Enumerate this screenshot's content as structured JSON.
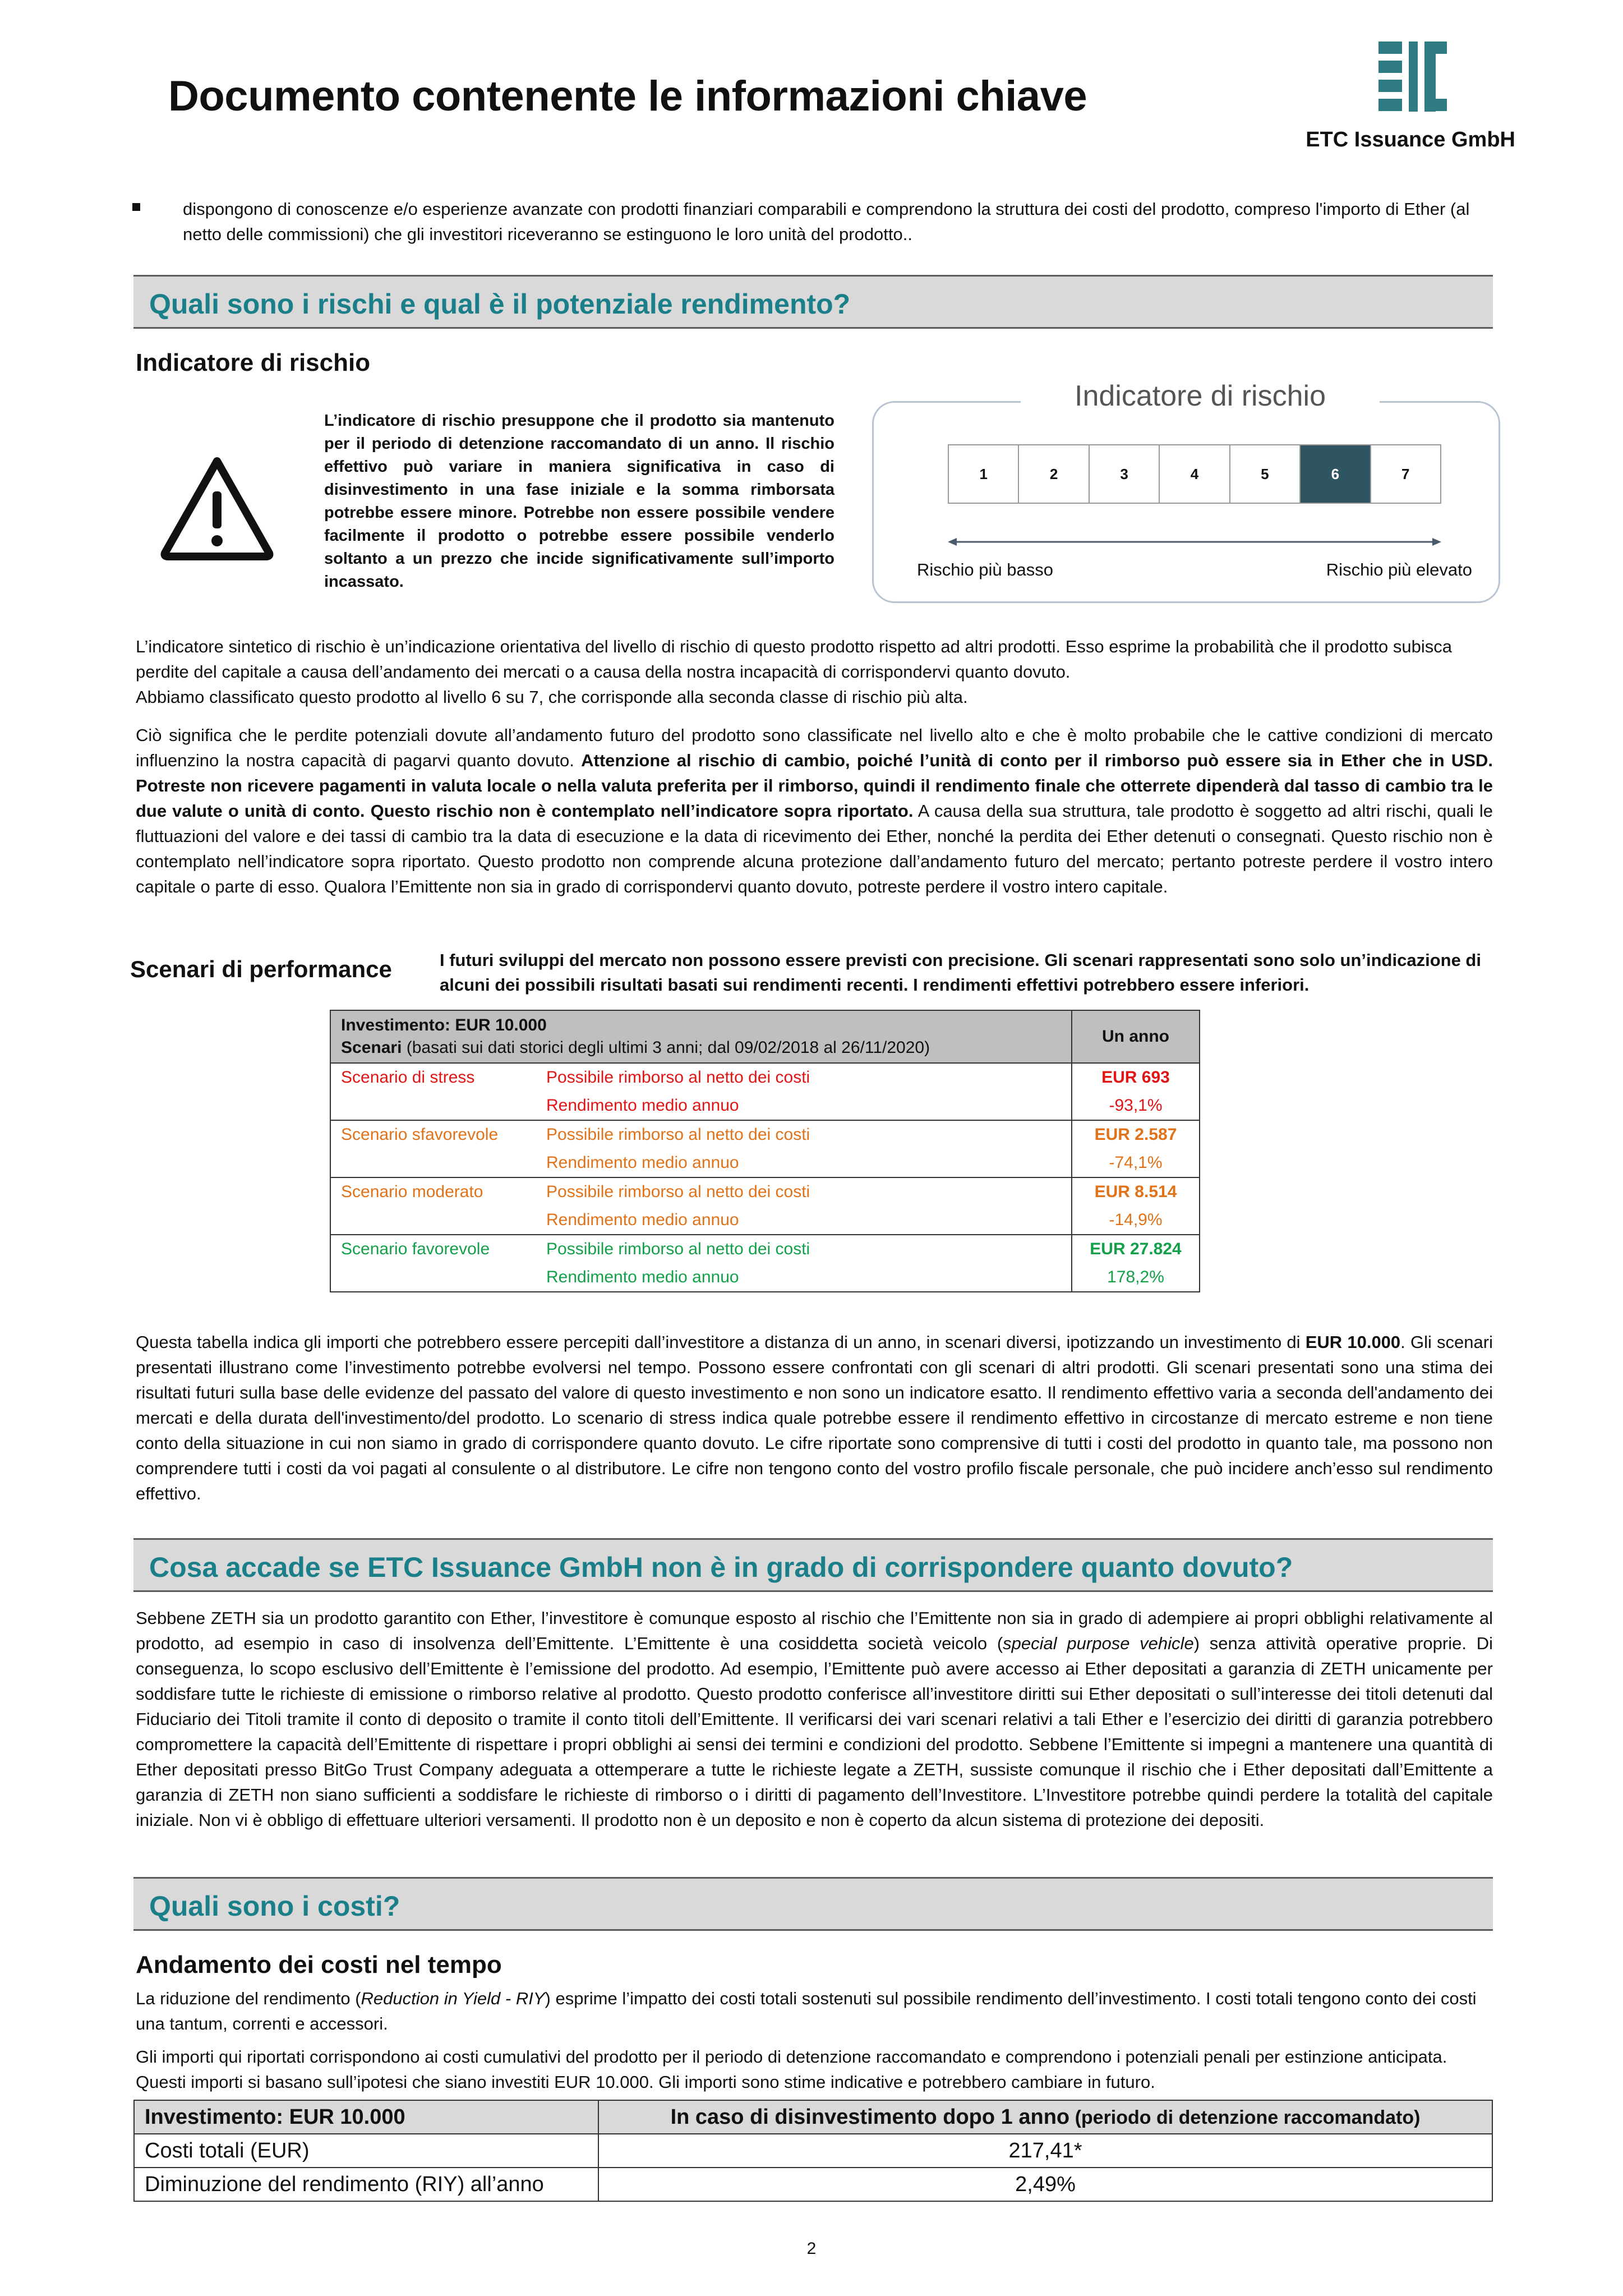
{
  "header": {
    "title": "Documento contenente le informazioni chiave",
    "issuer": "ETC Issuance GmbH"
  },
  "intro_bullet": "dispongono di conoscenze e/o esperienze avanzate con prodotti finanziari comparabili e comprendono la struttura dei costi del prodotto, compreso l'importo di Ether (al netto delle commissioni) che gli investitori riceveranno se estinguono le loro unità del prodotto..",
  "risk_section": {
    "heading": "Quali sono i rischi e qual è il potenziale rendimento?",
    "subheading": "Indicatore di rischio",
    "warning_text": "L’indicatore di rischio presuppone che il prodotto sia mantenuto per il periodo di detenzione raccomandato di un anno. Il rischio effettivo può variare in maniera significativa in caso di disinvestimento in una fase iniziale e la somma rimborsata potrebbe essere minore. Potrebbe non essere possibile vendere facilmente il prodotto o potrebbe essere possibile venderlo soltanto a un prezzo che incide significativamente sull’importo incassato.",
    "indicator": {
      "title": "Indicatore di rischio",
      "levels": [
        "1",
        "2",
        "3",
        "4",
        "5",
        "6",
        "7"
      ],
      "selected": 6,
      "selected_color": "#2f5563",
      "low_label": "Rischio più basso",
      "high_label": "Rischio più elevato"
    },
    "para1": "L’indicatore sintetico di rischio è un’indicazione orientativa del livello di rischio di questo prodotto rispetto ad altri prodotti. Esso esprime la probabilità che il prodotto subisca perdite del capitale a causa dell’andamento dei mercati o a causa della nostra incapacità di corrispondervi quanto dovuto.",
    "para1b": "Abbiamo classificato questo prodotto al livello 6 su 7, che corrisponde alla seconda classe di rischio più alta.",
    "para2_a": "Ciò significa che le perdite potenziali dovute all’andamento futuro del prodotto sono classificate nel livello alto e che è molto probabile che le cattive condizioni di mercato influenzino la nostra capacità di pagarvi quanto dovuto. ",
    "para2_bold": "Attenzione al rischio di cambio, poiché l’unità di conto per il rimborso può essere sia in Ether che in USD. Potreste non ricevere pagamenti in valuta locale o nella valuta preferita per il rimborso, quindi il rendimento finale che otterrete dipenderà dal tasso di cambio tra le due valute o unità di conto. Questo rischio non è contemplato nell’indicatore sopra riportato.",
    "para2_c": " A causa della sua struttura, tale prodotto è soggetto ad altri rischi, quali le fluttuazioni del valore e dei tassi di cambio tra la data di esecuzione e la data di ricevimento dei Ether, nonché la perdita dei Ether detenuti o consegnati. Questo rischio non è contemplato nell’indicatore sopra riportato. Questo prodotto non comprende alcuna protezione dall’andamento futuro del mercato; pertanto potreste perdere il vostro intero capitale o parte di esso. Qualora l’Emittente non sia in grado di corrispondervi quanto dovuto, potreste perdere il vostro intero capitale."
  },
  "performance": {
    "heading": "Scenari di performance",
    "intro": "I futuri sviluppi del mercato non possono essere previsti con precisione. Gli scenari rappresentati sono solo un’indicazione di alcuni dei possibili risultati basati sui rendimenti recenti. I rendimenti effettivi potrebbero essere inferiori.",
    "table": {
      "investment": "Investimento: EUR 10.000",
      "scenarios_label": "Scenari",
      "scenarios_note": " (basati sui dati storici degli ultimi 3 anni; dal 09/02/2018 al 26/11/2020)",
      "period": "Un anno",
      "rows": [
        {
          "name": "Scenario di stress",
          "l1": "Possibile rimborso al netto dei costi",
          "l2": "Rendimento medio annuo",
          "v1": "EUR 693",
          "v2": "-93,1%",
          "color": "#e01515"
        },
        {
          "name": "Scenario sfavorevole",
          "l1": "Possibile rimborso al netto dei costi",
          "l2": "Rendimento medio annuo",
          "v1": "EUR 2.587",
          "v2": "-74,1%",
          "color": "#e0731a"
        },
        {
          "name": "Scenario moderato",
          "l1": "Possibile rimborso al netto dei costi",
          "l2": "Rendimento medio annuo",
          "v1": "EUR 8.514",
          "v2": "-14,9%",
          "color": "#e0731a"
        },
        {
          "name": "Scenario favorevole",
          "l1": "Possibile rimborso al netto dei costi",
          "l2": "Rendimento medio annuo",
          "v1": "EUR 27.824",
          "v2": "178,2%",
          "color": "#14a04a"
        }
      ]
    },
    "after_a": "Questa tabella indica gli importi che potrebbero essere percepiti dall’investitore a distanza di un anno, in scenari diversi, ipotizzando un investimento di ",
    "after_bold": "EUR 10.000",
    "after_b": ". Gli scenari presentati illustrano come l’investimento potrebbe evolversi nel tempo. Possono essere confrontati con gli scenari di altri prodotti. Gli scenari presentati sono una stima dei risultati futuri sulla base delle evidenze del passato del valore di questo investimento e non sono un indicatore esatto. Il rendimento effettivo varia a seconda dell'andamento dei mercati e della durata dell'investimento/del prodotto. Lo scenario di stress indica quale potrebbe essere il rendimento effettivo in circostanze di mercato estreme e non tiene conto della situazione in cui non siamo in grado di corrispondere quanto dovuto. Le cifre riportate sono comprensive di tutti i costi del prodotto in quanto tale, ma possono non comprendere tutti i costi da voi pagati al consulente o al distributore. Le cifre non tengono conto del vostro profilo fiscale personale, che può incidere anch’esso sul rendimento effettivo."
  },
  "default_section": {
    "heading": "Cosa accade se ETC Issuance GmbH non è in grado di corrispondere quanto dovuto?",
    "text_a": "Sebbene ZETH sia un prodotto garantito con Ether, l’investitore è comunque esposto al rischio che l’Emittente non sia in grado di adempiere ai propri obblighi relativamente al prodotto, ad esempio in caso di insolvenza dell’Emittente. L’Emittente è una cosiddetta società veicolo (",
    "text_italic": "special purpose vehicle",
    "text_b": ") senza attività operative proprie. Di conseguenza, lo scopo esclusivo dell’Emittente è l’emissione del prodotto. Ad esempio, l’Emittente può avere accesso ai Ether depositati a garanzia di ZETH unicamente per soddisfare tutte le richieste di emissione o rimborso relative al prodotto. Questo prodotto conferisce all’investitore diritti sui Ether depositati o sull’interesse dei titoli detenuti dal Fiduciario dei Titoli tramite il conto di deposito o tramite il conto titoli dell’Emittente. Il verificarsi dei vari scenari relativi a tali Ether e l’esercizio dei diritti di garanzia potrebbero compromettere la capacità dell’Emittente di rispettare i propri obblighi ai sensi dei termini e condizioni del prodotto. Sebbene l’Emittente si impegni a mantenere una quantità di Ether depositati presso BitGo Trust Company adeguata a ottemperare a tutte le richieste legate a ZETH, sussiste comunque il rischio che i Ether depositati dall’Emittente a garanzia di ZETH non siano sufficienti a soddisfare le richieste di rimborso o i diritti di pagamento dell’Investitore. L’Investitore potrebbe quindi perdere la totalità del capitale iniziale. Non vi è obbligo di effettuare ulteriori versamenti. Il prodotto non è un deposito e non è coperto da alcun sistema di protezione dei depositi."
  },
  "costs_section": {
    "heading": "Quali sono i costi?",
    "subheading": "Andamento dei costi nel tempo",
    "p1_a": "La riduzione del rendimento (",
    "p1_italic": "Reduction in Yield - RIY",
    "p1_b": ") esprime l’impatto dei costi totali sostenuti sul possibile rendimento dell’investimento. I costi totali tengono conto dei costi una tantum, correnti e accessori.",
    "p2": "Gli importi qui riportati corrispondono ai costi cumulativi del prodotto per il periodo di detenzione raccomandato e comprendono i potenziali penali per estinzione anticipata. Questi importi si basano sull’ipotesi che siano investiti EUR 10.000. Gli importi sono stime indicative e potrebbero cambiare in futuro.",
    "table": {
      "h1": "Investimento: EUR 10.000",
      "h2_main": "In caso di disinvestimento dopo 1 anno",
      "h2_note": " (periodo di detenzione raccomandato)",
      "r1_label": "Costi totali (EUR)",
      "r1_value": "217,41*",
      "r2_label": "Diminuzione del rendimento (RIY) all’anno",
      "r2_value": "2,49%"
    }
  },
  "page_number": "2",
  "colors": {
    "accent": "#1b7f8a",
    "bar": "#d9d9d9",
    "stress": "#e01515",
    "moderate": "#e0731a",
    "favorable": "#14a04a"
  }
}
